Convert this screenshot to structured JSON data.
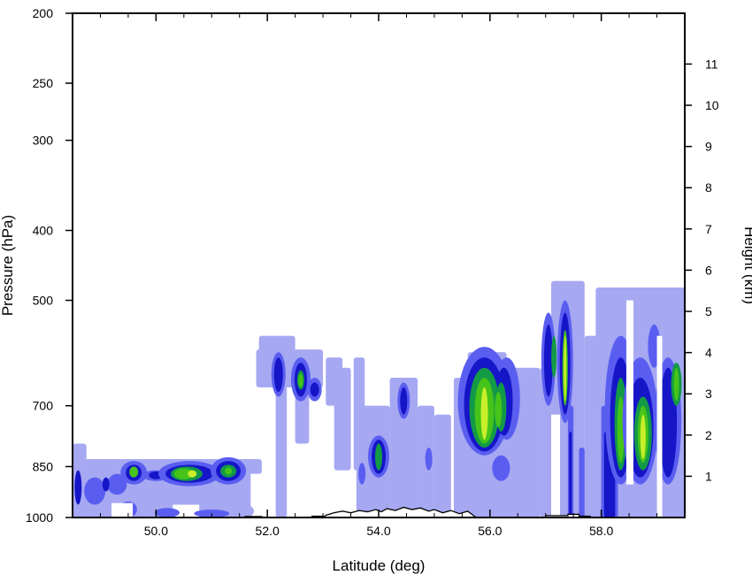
{
  "chart_data": {
    "type": "heatmap",
    "title": "",
    "xlabel": "Latitude (deg)",
    "ylabel_left": "Pressure (hPa)",
    "ylabel_right": "Height (km)",
    "x_range": [
      48.5,
      59.5
    ],
    "x_ticks": [
      "50.0",
      "52.0",
      "54.0",
      "56.0",
      "58.0"
    ],
    "x_tick_values": [
      50,
      52,
      54,
      56,
      58
    ],
    "y_left_scale": "log",
    "y_left_range": [
      1000,
      200
    ],
    "y_left_ticks": [
      "200",
      "250",
      "300",
      "400",
      "500",
      "700",
      "850",
      "1000"
    ],
    "y_left_tick_values": [
      200,
      250,
      300,
      400,
      500,
      700,
      850,
      1000
    ],
    "y_right_ticks": [
      "1",
      "2",
      "3",
      "4",
      "5",
      "6",
      "7",
      "8",
      "9",
      "10",
      "11"
    ],
    "y_right_tick_values": [
      1,
      2,
      3,
      4,
      5,
      6,
      7,
      8,
      9,
      10,
      11
    ],
    "contour_colors": [
      "#a6a8f2",
      "#5a5ef0",
      "#1616c8",
      "#139a46",
      "#46c41a",
      "#c8ef2a"
    ],
    "contour_cells": [
      {
        "lat": 48.6,
        "p_top": 820,
        "p_bot": 1000,
        "level": 1
      },
      {
        "lat": 49.6,
        "p_top": 845,
        "p_bot": 880,
        "level": 5
      },
      {
        "lat": 50.6,
        "p_top": 845,
        "p_bot": 885,
        "level": 4
      },
      {
        "lat": 51.3,
        "p_top": 845,
        "p_bot": 880,
        "level": 4
      },
      {
        "lat": 52.2,
        "p_top": 590,
        "p_bot": 700,
        "level": 3
      },
      {
        "lat": 52.6,
        "p_top": 600,
        "p_bot": 690,
        "level": 4
      },
      {
        "lat": 54.0,
        "p_top": 780,
        "p_bot": 870,
        "level": 4
      },
      {
        "lat": 54.4,
        "p_top": 660,
        "p_bot": 720,
        "level": 2
      },
      {
        "lat": 55.9,
        "p_top": 600,
        "p_bot": 800,
        "level": 6
      },
      {
        "lat": 57.3,
        "p_top": 520,
        "p_bot": 680,
        "level": 5
      },
      {
        "lat": 58.6,
        "p_top": 560,
        "p_bot": 850,
        "level": 5
      },
      {
        "lat": 59.3,
        "p_top": 620,
        "p_bot": 700,
        "level": 4
      }
    ]
  }
}
